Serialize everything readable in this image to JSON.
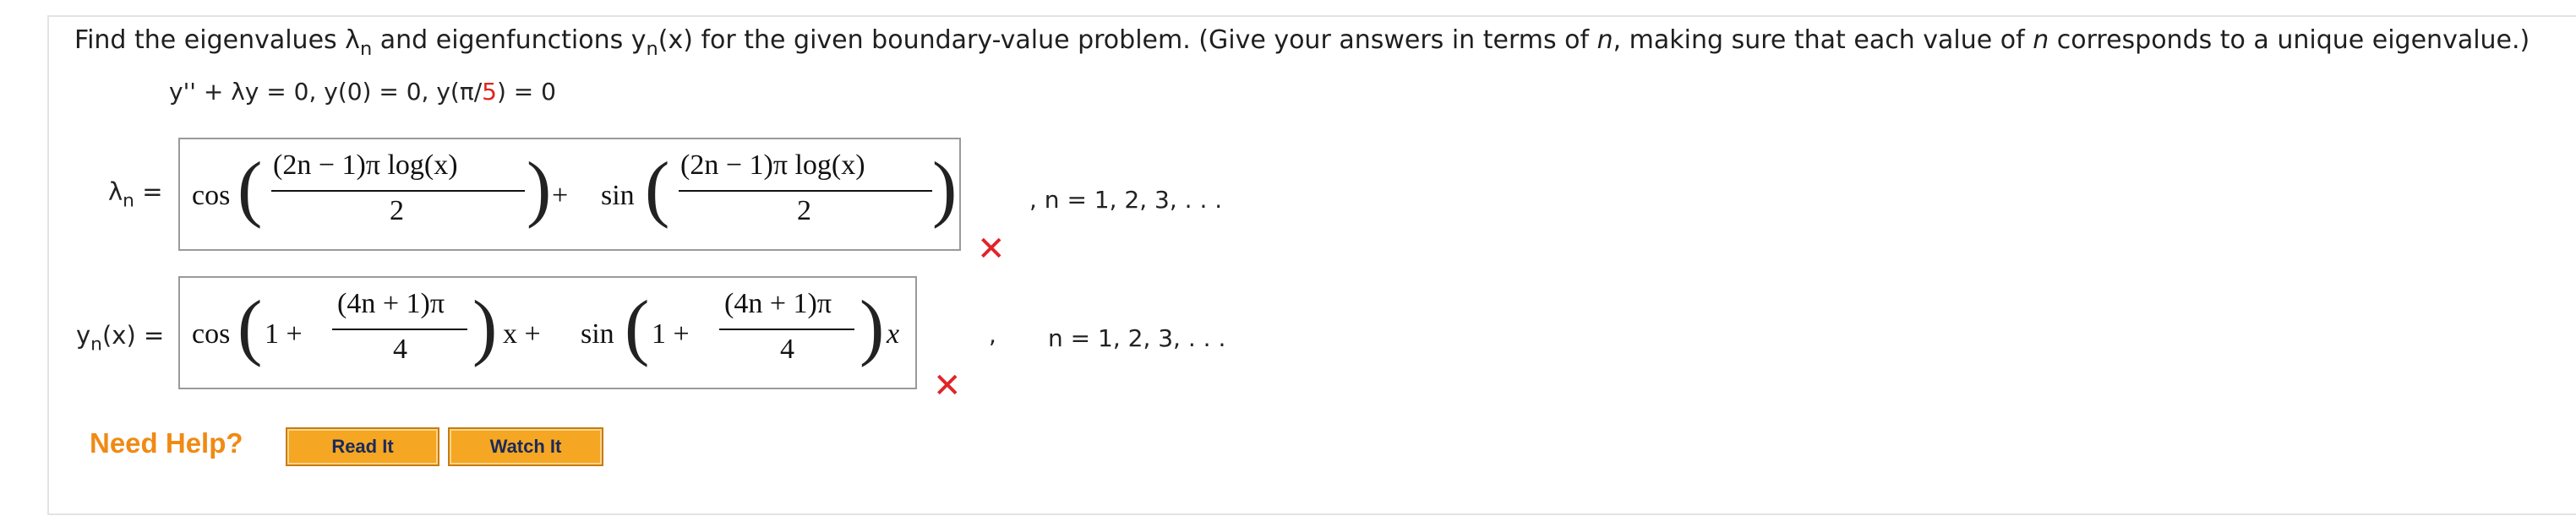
{
  "question": {
    "prefix": "Find the eigenvalues λ",
    "sub_n": "n",
    "mid": " and eigenfunctions y",
    "sub_n2": "n",
    "after_sub": "(x) for the given boundary-value problem. (Give your answers in terms of ",
    "n1": "n",
    "mid2": ", making sure that each value of ",
    "n2": "n",
    "suffix": " corresponds to a unique eigenvalue.)"
  },
  "equation": {
    "part1": "y'' + λy = 0,  y(0) = 0,  y(π/",
    "red": "5",
    "part2": ") = 0"
  },
  "lambda_row": {
    "label": "λ",
    "sub": "n",
    "eq": "=",
    "cos": "cos",
    "plus": "+",
    "sin": "sin",
    "num1": "(2n − 1)π log(x)",
    "den1": "2",
    "num2": "(2n − 1)π log(x)",
    "den2": "2",
    "range": ", n = 1, 2, 3, . . ."
  },
  "y_row": {
    "label": "y",
    "sub": "n",
    "after": "(x)",
    "eq": "=",
    "cos": "cos",
    "one1": "1 +",
    "num1": "(4n + 1)π",
    "den1": "4",
    "x_plus": "x +",
    "sin": "sin",
    "one2": "1 +",
    "num2": "(4n + 1)π",
    "den2": "4",
    "x": "x",
    "comma": ",",
    "range": "n = 1, 2, 3, . . ."
  },
  "status": {
    "incorrect_mark": "✕"
  },
  "help": {
    "label": "Need Help?",
    "read_it": "Read It",
    "watch_it": "Watch It"
  },
  "colors": {
    "accent_orange": "#f08a14",
    "button_orange": "#f5a623",
    "error_red": "#e0242a"
  }
}
